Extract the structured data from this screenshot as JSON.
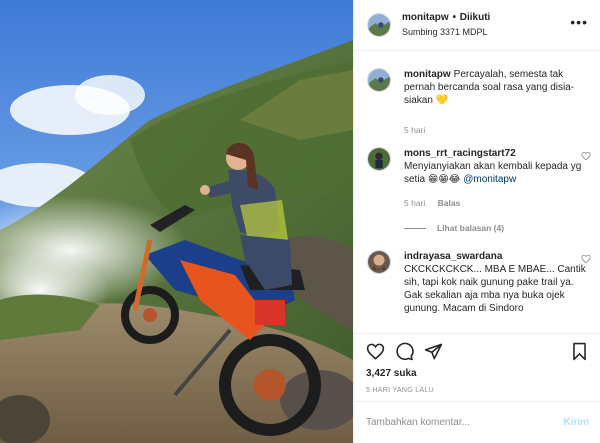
{
  "header": {
    "username": "monitapw",
    "follow_status": "Diikuti",
    "location": "Sumbing 3371 MDPL",
    "more_glyph": "•••"
  },
  "caption": {
    "username": "monitapw",
    "text": "Percayalah, semesta tak pernah bercanda soal rasa yang disia-siakan",
    "emoji": "💛",
    "time": "5 hari"
  },
  "comments": [
    {
      "username": "mons_rrt_racingstart72",
      "text": "Menyianyiakan akan kembali kepada yg setia",
      "emoji": "😁😁😂",
      "mention": "@monitapw",
      "time": "5 hari",
      "reply_label": "Balas",
      "view_replies": "Lihat balasan (4)"
    },
    {
      "username": "indrayasa_swardana",
      "text": "CKCKCKCKCK... MBA E MBAE... Cantik sih, tapi kok naik gunung pake trail ya. Gak sekalian aja mba nya buka ojek gunung. Macam di Sindoro"
    }
  ],
  "actions": {
    "likes": "3,427 suka",
    "time_ago": "5 HARI YANG LALU"
  },
  "add_comment": {
    "placeholder": "Tambahkan komentar...",
    "post_label": "Kirim"
  },
  "colors": {
    "accent_disabled": "#b2dffc",
    "link": "#00376b",
    "muted": "#8e8e8e",
    "border": "#efefef"
  },
  "icons": [
    "more-icon",
    "heart-icon",
    "comment-icon",
    "share-icon",
    "bookmark-icon",
    "small-heart-icon"
  ]
}
